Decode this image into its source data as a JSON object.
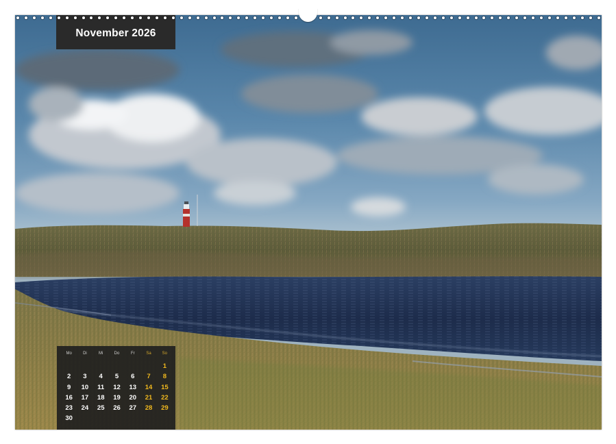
{
  "header": {
    "month_title": "November 2026"
  },
  "calendar": {
    "weekdays": [
      "Mo",
      "Di",
      "Mi",
      "Do",
      "Fr",
      "Sa",
      "So"
    ],
    "weekend_color": "#f0b81e",
    "leading_blanks": 6,
    "days": [
      "1",
      "2",
      "3",
      "4",
      "5",
      "6",
      "7",
      "8",
      "9",
      "10",
      "11",
      "12",
      "13",
      "14",
      "15",
      "16",
      "17",
      "18",
      "19",
      "20",
      "21",
      "22",
      "23",
      "24",
      "25",
      "26",
      "27",
      "28",
      "29",
      "30"
    ]
  },
  "photo": {
    "subject": "lighthouse-in-dune-landscape",
    "colors": {
      "sky": "#5a87ab",
      "water": "#1f2f4f",
      "grass": "#8a7a45"
    }
  }
}
